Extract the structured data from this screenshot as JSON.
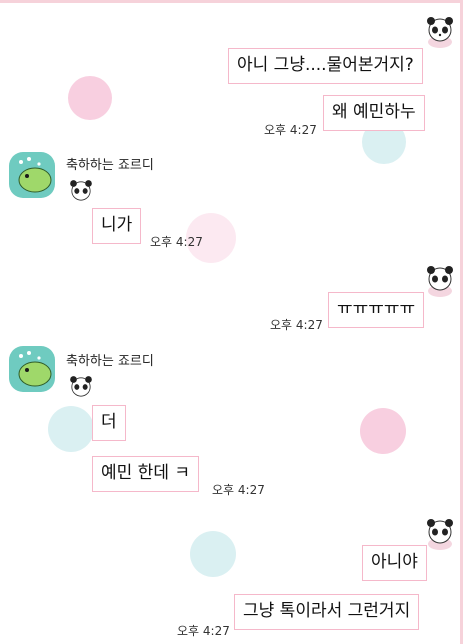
{
  "colors": {
    "bubble_border": "#f5b8ca",
    "dot_pink": "#f8cfe0",
    "dot_blue": "#daf0f2",
    "avatar_bg": "#6fcbc0",
    "text": "#111111"
  },
  "icons": {
    "sticker": "panda-sticker-icon",
    "avatar": "green-character-avatar-icon"
  },
  "messages": [
    {
      "side": "right",
      "text": "아니 그냥....물어본거지?"
    },
    {
      "side": "right",
      "text": "왜 예민하누",
      "time": "오후 4:27"
    },
    {
      "side": "left",
      "sender": "축하하는 죠르디",
      "text": "니가",
      "time": "오후 4:27"
    },
    {
      "side": "right",
      "text": "ㅠㅠㅠㅠㅠ",
      "time": "오후 4:27"
    },
    {
      "side": "left",
      "sender": "축하하는 죠르디",
      "text": "더"
    },
    {
      "side": "left",
      "text": "예민 한데 ㅋ",
      "time": "오후 4:27"
    },
    {
      "side": "right",
      "text": "아니야"
    },
    {
      "side": "right",
      "text": "그냥 톡이라서 그런거지",
      "time": "오후 4:27"
    }
  ]
}
